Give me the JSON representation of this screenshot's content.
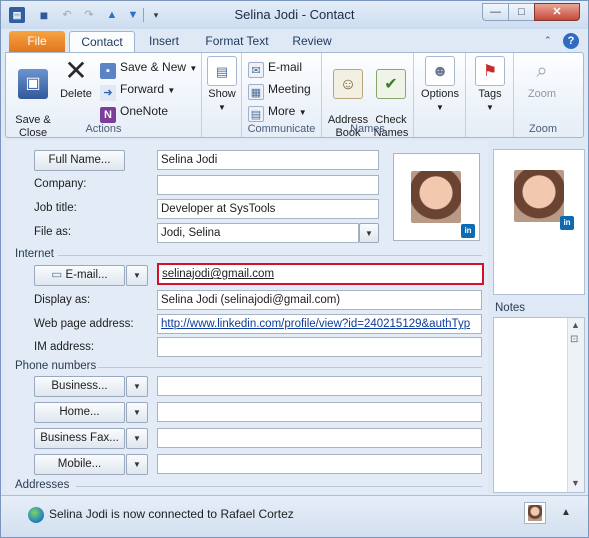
{
  "window": {
    "title": "Selina Jodi  -  Contact"
  },
  "qat": {
    "app_icon": "outlook-contact-icon",
    "more": "▾"
  },
  "tabs": [
    "File",
    "Contact",
    "Insert",
    "Format Text",
    "Review"
  ],
  "ribbon": {
    "actions": {
      "save_close": "Save &\nClose",
      "delete": "Delete",
      "save_new": "Save & New",
      "forward": "Forward",
      "onenote": "OneNote",
      "label": "Actions"
    },
    "show": {
      "show": "Show"
    },
    "communicate": {
      "email": "E-mail",
      "meeting": "Meeting",
      "more": "More",
      "label": "Communicate"
    },
    "names": {
      "address_book": "Address\nBook",
      "check_names": "Check\nNames",
      "label": "Names"
    },
    "options": {
      "options": "Options"
    },
    "tags": {
      "tags": "Tags"
    },
    "zoom": {
      "zoom": "Zoom",
      "label": "Zoom"
    }
  },
  "form": {
    "full_name_button": "Full Name...",
    "full_name_value": "Selina Jodi",
    "company_label": "Company:",
    "company_value": "",
    "job_title_label": "Job title:",
    "job_title_value": "Developer at SysTools",
    "file_as_label": "File as:",
    "file_as_value": "Jodi, Selina",
    "internet_section": "Internet",
    "email_button": "E-mail...",
    "email_value": "selinajodi@gmail.com",
    "display_as_label": "Display as:",
    "display_as_value": "Selina Jodi (selinajodi@gmail.com)",
    "web_page_label": "Web page address:",
    "web_page_value": "http://www.linkedin.com/profile/view?id=240215129&authTyp",
    "im_label": "IM address:",
    "im_value": "",
    "phone_section": "Phone numbers",
    "phones": [
      {
        "label": "Business...",
        "value": ""
      },
      {
        "label": "Home...",
        "value": ""
      },
      {
        "label": "Business Fax...",
        "value": ""
      },
      {
        "label": "Mobile...",
        "value": ""
      }
    ],
    "addresses_section": "Addresses"
  },
  "badges": {
    "linkedin": "in"
  },
  "notes": {
    "label": "Notes"
  },
  "status": {
    "text": "Selina Jodi is now connected to Rafael Cortez"
  },
  "colors": {
    "accent_file_tab": "#e2741b",
    "email_highlight_border": "#d4102a",
    "link": "#0b3c9c"
  }
}
